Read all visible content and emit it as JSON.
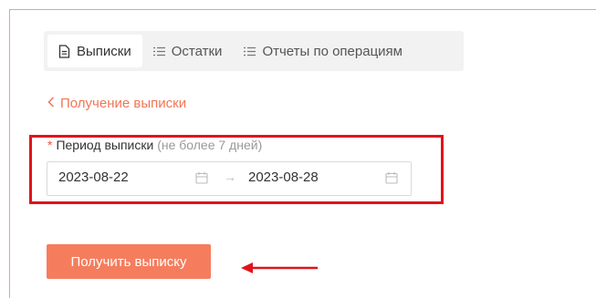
{
  "tabs": [
    {
      "label": "Выписки",
      "icon": "document-icon",
      "active": true
    },
    {
      "label": "Остатки",
      "icon": "list-icon",
      "active": false
    },
    {
      "label": "Отчеты по операциям",
      "icon": "list-icon",
      "active": false
    }
  ],
  "back_link": {
    "label": "Получение выписки",
    "icon": "chevron-left-icon"
  },
  "period": {
    "required_mark": "*",
    "label": "Период выписки",
    "hint": "(не более 7 дней)",
    "start_date": "2023-08-22",
    "end_date": "2023-08-28",
    "separator": "→"
  },
  "submit_label": "Получить выписку",
  "colors": {
    "accent": "#f57d5d",
    "link": "#f07556",
    "highlight_border": "#e0141b",
    "pointer_arrow": "#e0141b"
  }
}
